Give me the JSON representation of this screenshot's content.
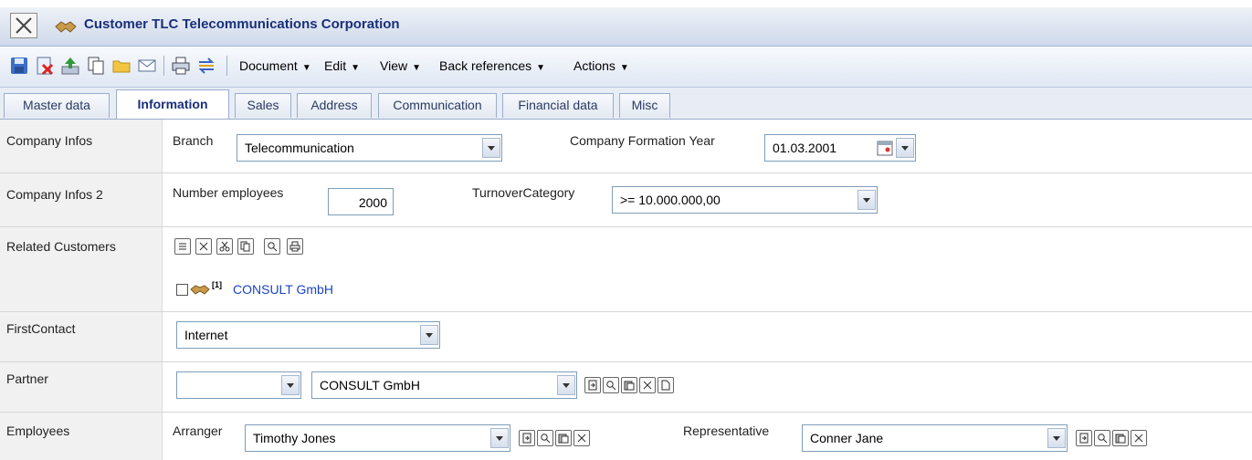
{
  "window": {
    "title": "Customer TLC Telecommunications Corporation"
  },
  "toolbar": {
    "icons": [
      "save-icon",
      "delete-icon",
      "upload-icon",
      "copy-icon",
      "folder-icon",
      "mail-icon",
      "print-icon",
      "transfer-icon"
    ],
    "menus": [
      {
        "label": "Document"
      },
      {
        "label": "Edit"
      },
      {
        "label": "View"
      },
      {
        "label": "Back references"
      },
      {
        "label": "Actions"
      }
    ]
  },
  "tabs": [
    {
      "label": "Master data",
      "active": false
    },
    {
      "label": "Information",
      "active": true
    },
    {
      "label": "Sales",
      "active": false
    },
    {
      "label": "Address",
      "active": false
    },
    {
      "label": "Communication",
      "active": false
    },
    {
      "label": "Financial data",
      "active": false
    },
    {
      "label": "Misc",
      "active": false
    }
  ],
  "form": {
    "company_infos": {
      "label": "Company Infos",
      "branch_label": "Branch",
      "branch_value": "Telecommunication",
      "formation_label": "Company Formation Year",
      "formation_value": "01.03.2001"
    },
    "company_infos2": {
      "label": "Company Infos 2",
      "employees_label": "Number employees",
      "employees_value": "2000",
      "turnover_label": "TurnoverCategory",
      "turnover_value": ">= 10.000.000,00"
    },
    "related_customers": {
      "label": "Related Customers",
      "badge": "[1]",
      "item": "CONSULT GmbH"
    },
    "first_contact": {
      "label": "FirstContact",
      "value": "Internet"
    },
    "partner": {
      "label": "Partner",
      "type_value": "",
      "value": "CONSULT GmbH"
    },
    "employees": {
      "label": "Employees",
      "arranger_label": "Arranger",
      "arranger_value": "Timothy Jones",
      "representative_label": "Representative",
      "representative_value": "Conner Jane"
    }
  }
}
